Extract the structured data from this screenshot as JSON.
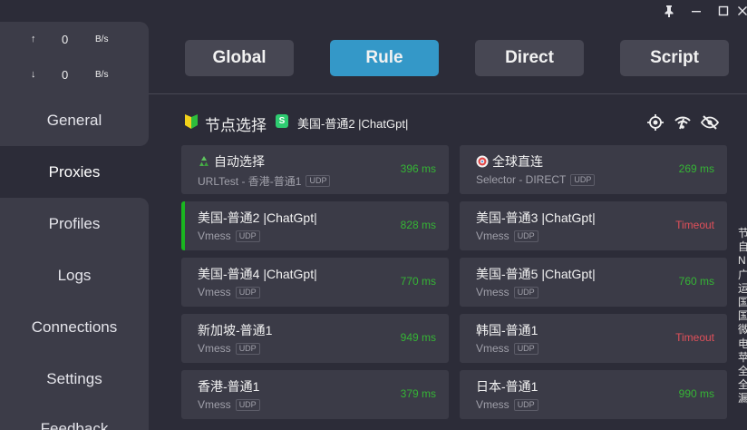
{
  "window_controls": {
    "pin": "pin-icon",
    "minimize": "minimize-icon",
    "maximize": "maximize-icon",
    "close": "close-icon"
  },
  "traffic": {
    "upload_arrow": "↑",
    "upload_value": "0",
    "upload_unit": "B/s",
    "download_arrow": "↓",
    "download_value": "0",
    "download_unit": "B/s"
  },
  "sidebar": {
    "items": [
      {
        "label": "General"
      },
      {
        "label": "Proxies"
      },
      {
        "label": "Profiles"
      },
      {
        "label": "Logs"
      },
      {
        "label": "Connections"
      },
      {
        "label": "Settings"
      },
      {
        "label": "Feedback"
      }
    ],
    "active": "Proxies"
  },
  "modes": {
    "global": "Global",
    "rule": "Rule",
    "direct": "Direct",
    "script": "Script",
    "active": "Rule"
  },
  "group": {
    "name": "节点选择",
    "badge": "S",
    "current": "美国-普通2 |ChatGpt|",
    "icons": [
      "locate-icon",
      "speed-test-icon",
      "hide-icon"
    ]
  },
  "proxies": [
    {
      "name": "自动选择",
      "icon": "recycle-icon",
      "type": "URLTest - 香港-普通1",
      "udp": "UDP",
      "delay": "396 ms",
      "timeout": false,
      "selected": false
    },
    {
      "name": "全球直连",
      "icon": "target-icon",
      "type": "Selector - DIRECT",
      "udp": "UDP",
      "delay": "269 ms",
      "timeout": false,
      "selected": false
    },
    {
      "name": "美国-普通2 |ChatGpt|",
      "type": "Vmess",
      "udp": "UDP",
      "delay": "828 ms",
      "timeout": false,
      "selected": true
    },
    {
      "name": "美国-普通3 |ChatGpt|",
      "type": "Vmess",
      "udp": "UDP",
      "delay": "Timeout",
      "timeout": true,
      "selected": false
    },
    {
      "name": "美国-普通4 |ChatGpt|",
      "type": "Vmess",
      "udp": "UDP",
      "delay": "770 ms",
      "timeout": false,
      "selected": false
    },
    {
      "name": "美国-普通5 |ChatGpt|",
      "type": "Vmess",
      "udp": "UDP",
      "delay": "760 ms",
      "timeout": false,
      "selected": false
    },
    {
      "name": "新加坡-普通1",
      "type": "Vmess",
      "udp": "UDP",
      "delay": "949 ms",
      "timeout": false,
      "selected": false
    },
    {
      "name": "韩国-普通1",
      "type": "Vmess",
      "udp": "UDP",
      "delay": "Timeout",
      "timeout": true,
      "selected": false
    },
    {
      "name": "香港-普通1",
      "type": "Vmess",
      "udp": "UDP",
      "delay": "379 ms",
      "timeout": false,
      "selected": false
    },
    {
      "name": "日本-普通1",
      "type": "Vmess",
      "udp": "UDP",
      "delay": "990 ms",
      "timeout": false,
      "selected": false
    }
  ],
  "right_strip": [
    "节",
    "自",
    "N",
    "广",
    "运",
    "国",
    "国",
    "微",
    "电",
    "苹",
    "全",
    "全",
    "漏"
  ],
  "colors": {
    "accent": "#3498c8",
    "selected_bar": "#1ab620",
    "delay_ok": "#35b535",
    "delay_timeout": "#e0505a",
    "badge": "#2ecc71"
  }
}
